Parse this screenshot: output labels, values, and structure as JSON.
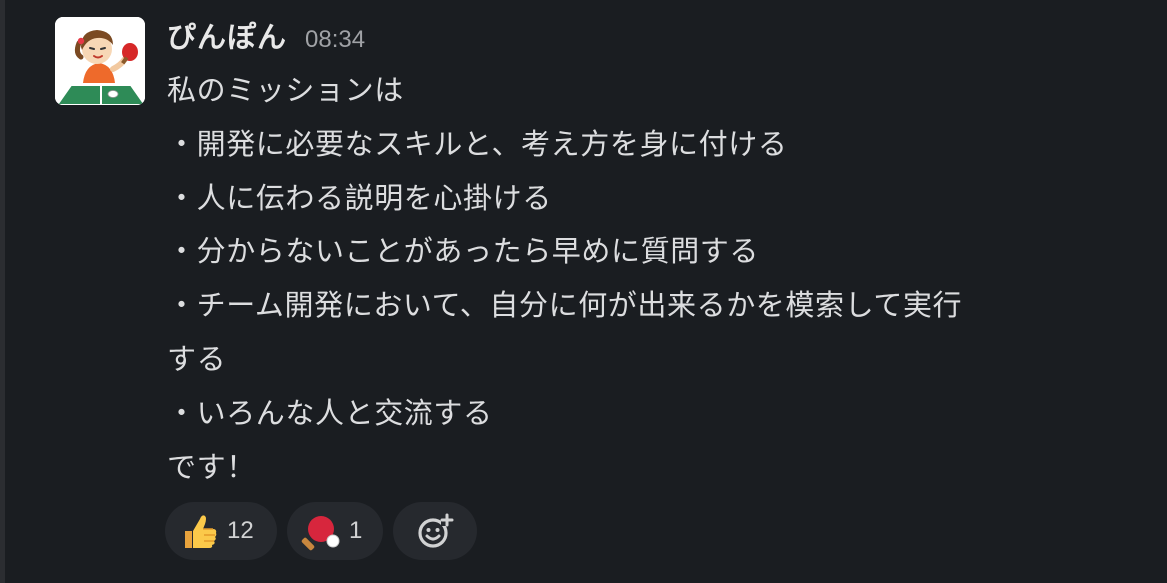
{
  "message": {
    "author": "ぴんぽん",
    "time": "08:34",
    "lines": [
      "私のミッションは",
      "・開発に必要なスキルと、考え方を身に付ける",
      "・人に伝わる説明を心掛ける",
      "・分からないことがあったら早めに質問する",
      "・チーム開発において、自分に何が出来るかを模索して実行",
      "する",
      "・いろんな人と交流する",
      "です！"
    ]
  },
  "reactions": [
    {
      "emoji": "thumbs-up-icon",
      "count": "12"
    },
    {
      "emoji": "ping-pong-icon",
      "count": "1"
    }
  ],
  "colors": {
    "background": "#1a1d21",
    "text": "#dcdddf",
    "muted": "#a0a2a6",
    "pill": "#26292e"
  }
}
